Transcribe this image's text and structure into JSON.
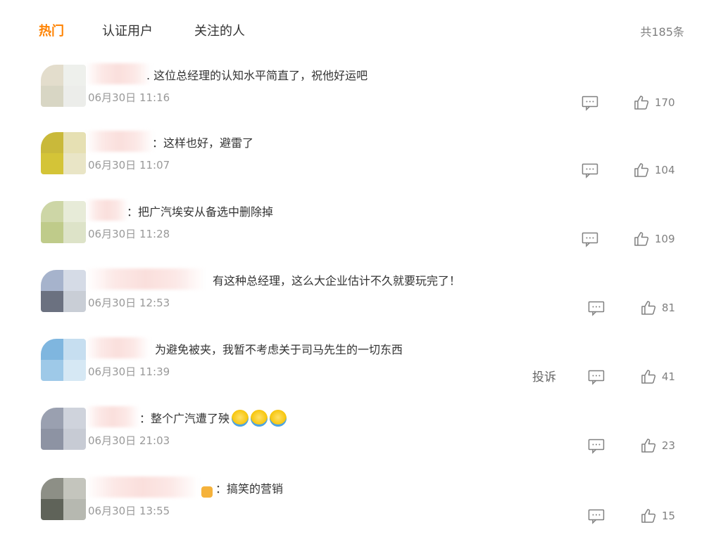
{
  "tabs": [
    {
      "label": "热门",
      "active": true
    },
    {
      "label": "认证用户",
      "active": false
    },
    {
      "label": "关注的人",
      "active": false
    }
  ],
  "total": "共185条",
  "report_label": "投诉",
  "comments": [
    {
      "text": ". 这位总经理的认知水平简直了，祝他好运吧",
      "time": "06月30日 11:16",
      "likes": "170",
      "avatar_colors": [
        "#e3ddcc",
        "#eef0ec",
        "#d8d6c4",
        "#ecedea"
      ]
    },
    {
      "text": "：这样也好，避雷了",
      "time": "06月30日 11:07",
      "likes": "104",
      "avatar_colors": [
        "#c9b93a",
        "#e6e0b3",
        "#d4c437",
        "#e9e5c6"
      ]
    },
    {
      "text": "：把广汽埃安从备选中删除掉",
      "time": "06月30日 11:28",
      "likes": "109",
      "avatar_colors": [
        "#cdd6a6",
        "#e7ebd8",
        "#bfcb8a",
        "#dde3c8"
      ]
    },
    {
      "text": "有这种总经理，这么大企业估计不久就要玩完了！",
      "time": "06月30日 12:53",
      "likes": "81",
      "avatar_colors": [
        "#a6b3cc",
        "#d5dbe6",
        "#6b7180",
        "#c9ced6"
      ]
    },
    {
      "text": "为避免被夹，我暂不考虑关于司马先生的一切东西",
      "time": "06月30日 11:39",
      "likes": "41",
      "avatar_colors": [
        "#7fb6df",
        "#c6def0",
        "#9ec9e8",
        "#d6e8f4"
      ]
    },
    {
      "text": "：整个广汽遭了殃",
      "time": "06月30日 21:03",
      "likes": "23",
      "avatar_colors": [
        "#9aa0b0",
        "#cfd3dc",
        "#8d93a3",
        "#c7cbd4"
      ]
    },
    {
      "text": "：搞笑的营销",
      "time": "06月30日 13:55",
      "likes": "15",
      "avatar_colors": [
        "#8d8f86",
        "#c4c5bd",
        "#5f6359",
        "#b6b8b0"
      ]
    }
  ],
  "icons": {
    "reply": "reply-icon",
    "like": "like-icon",
    "emoji": "laughing-crying-emoji"
  },
  "colors": {
    "accent": "#ff8200",
    "muted": "#808080"
  }
}
